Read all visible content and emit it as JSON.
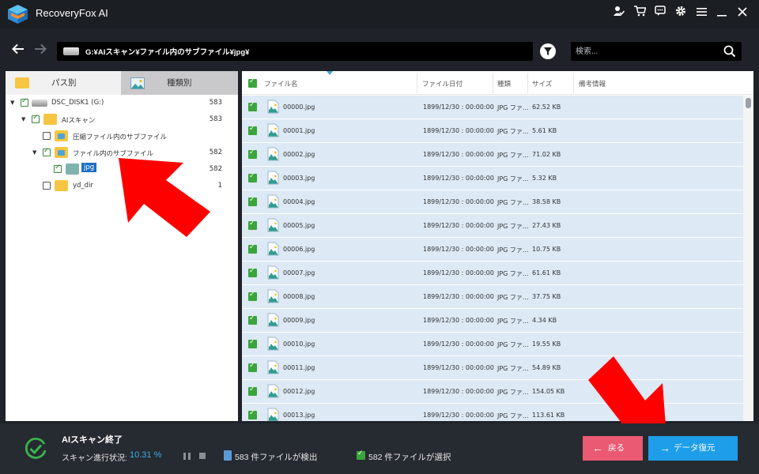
{
  "app": {
    "title": "RecoveryFox AI"
  },
  "titlebar_icons": [
    "user-check-icon",
    "cart-icon",
    "chat-icon",
    "gear-icon",
    "menu-icon",
    "minimize-icon",
    "close-icon"
  ],
  "nav": {
    "path": "G:¥AIスキャン¥ファイル内のサブファイル¥jpg¥",
    "search_placeholder": "検索..."
  },
  "left_tabs": [
    {
      "label": "パス別",
      "icon": "folder-icon",
      "active": true
    },
    {
      "label": "種類別",
      "icon": "image-icon",
      "active": false
    }
  ],
  "tree": [
    {
      "label": "DSC_DISK1 (G:)",
      "count": "583",
      "checked": true,
      "expand": "▼",
      "icon": "drive-icon"
    },
    {
      "label": "AIスキャン",
      "count": "583",
      "checked": true,
      "expand": "▼",
      "icon": "folder-icon"
    },
    {
      "label": "圧縮ファイル内のサブファイル",
      "count": "",
      "checked": false,
      "expand": "",
      "icon": "image-folder-icon"
    },
    {
      "label": "ファイル内のサブファイル",
      "count": "582",
      "checked": true,
      "expand": "▼",
      "icon": "image-folder-icon"
    },
    {
      "label": "jpg",
      "count": "582",
      "checked": true,
      "expand": "",
      "icon": "folder-icon",
      "selected": true
    },
    {
      "label": "yd_dir",
      "count": "1",
      "checked": false,
      "expand": "",
      "icon": "folder-icon"
    }
  ],
  "table": {
    "headers": [
      "ファイル名",
      "ファイル日付",
      "種類",
      "サイズ",
      "備考情報"
    ],
    "rows": [
      {
        "name": "00000.jpg",
        "date": "1899/12/30 : 00:00:00",
        "type": "JPG ファ...",
        "size": "62.52 KB"
      },
      {
        "name": "00001.jpg",
        "date": "1899/12/30 : 00:00:00",
        "type": "JPG ファ...",
        "size": "5.61 KB"
      },
      {
        "name": "00002.jpg",
        "date": "1899/12/30 : 00:00:00",
        "type": "JPG ファ...",
        "size": "71.02 KB"
      },
      {
        "name": "00003.jpg",
        "date": "1899/12/30 : 00:00:00",
        "type": "JPG ファ...",
        "size": "5.32 KB"
      },
      {
        "name": "00004.jpg",
        "date": "1899/12/30 : 00:00:00",
        "type": "JPG ファ...",
        "size": "38.58 KB"
      },
      {
        "name": "00005.jpg",
        "date": "1899/12/30 : 00:00:00",
        "type": "JPG ファ...",
        "size": "27.43 KB"
      },
      {
        "name": "00006.jpg",
        "date": "1899/12/30 : 00:00:00",
        "type": "JPG ファ...",
        "size": "10.75 KB"
      },
      {
        "name": "00007.jpg",
        "date": "1899/12/30 : 00:00:00",
        "type": "JPG ファ...",
        "size": "61.61 KB"
      },
      {
        "name": "00008.jpg",
        "date": "1899/12/30 : 00:00:00",
        "type": "JPG ファ...",
        "size": "37.75 KB"
      },
      {
        "name": "00009.jpg",
        "date": "1899/12/30 : 00:00:00",
        "type": "JPG ファ...",
        "size": "4.34 KB"
      },
      {
        "name": "00010.jpg",
        "date": "1899/12/30 : 00:00:00",
        "type": "JPG ファ...",
        "size": "19.55 KB"
      },
      {
        "name": "00011.jpg",
        "date": "1899/12/30 : 00:00:00",
        "type": "JPG ファ...",
        "size": "54.89 KB"
      },
      {
        "name": "00012.jpg",
        "date": "1899/12/30 : 00:00:00",
        "type": "JPG ファ...",
        "size": "154.05 KB"
      },
      {
        "name": "00013.jpg",
        "date": "1899/12/30 : 00:00:00",
        "type": "JPG ファ...",
        "size": "113.61 KB"
      }
    ]
  },
  "status": {
    "title": "AIスキャン終了",
    "progress_label": "スキャン進行状況:",
    "progress_value": "10.31 %",
    "found": "583 件ファイルが検出",
    "selected": "582 件ファイルが選択"
  },
  "buttons": {
    "back": "戻る",
    "recover": "データ復元"
  },
  "colors": {
    "accent_blue": "#1e9ee8",
    "back_pink": "#ea5a72",
    "check_green": "#3aa53a",
    "row_bg": "#dde9f5",
    "annotation_red": "#ff0000"
  }
}
